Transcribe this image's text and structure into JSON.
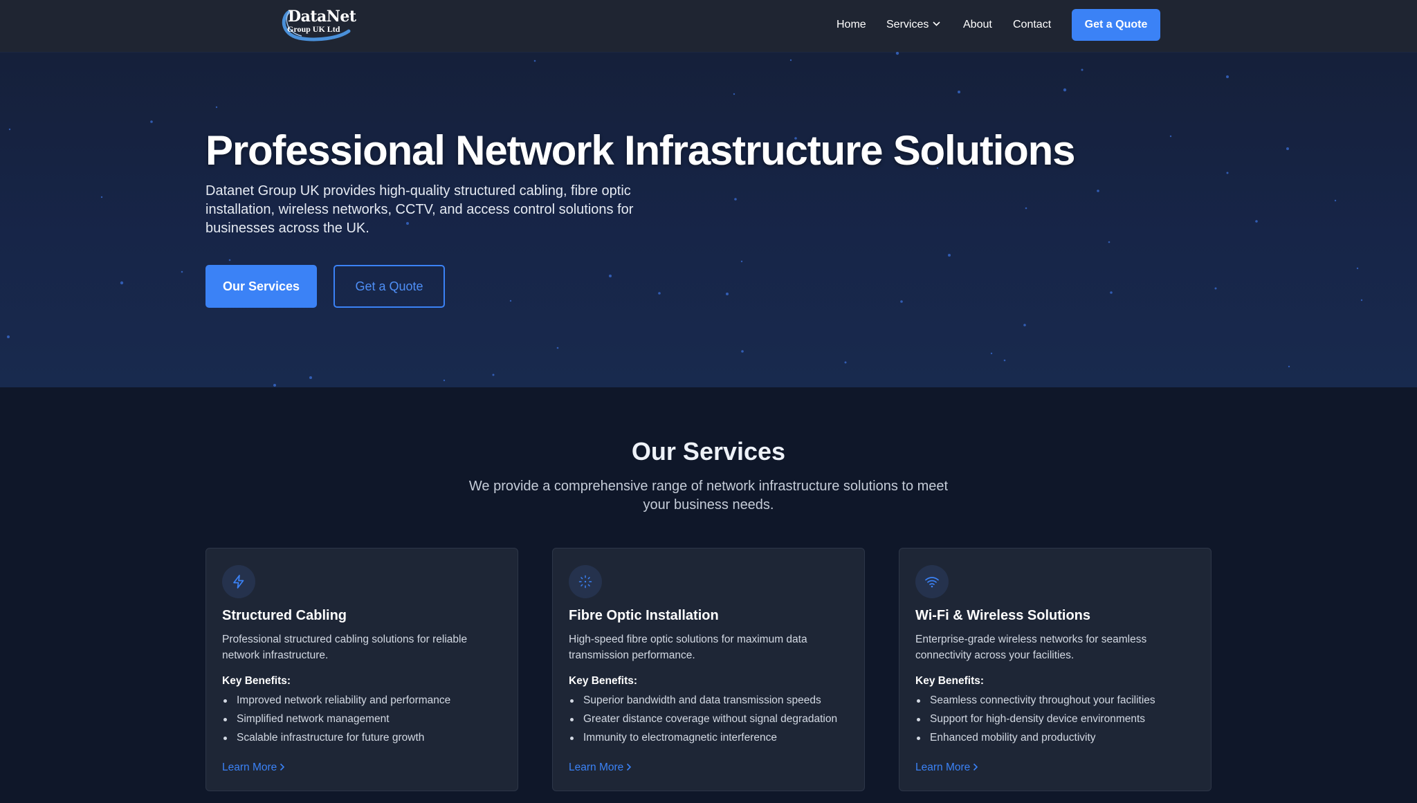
{
  "header": {
    "logo": {
      "name": "DataNet",
      "sub": "Group UK Ltd"
    },
    "nav": [
      {
        "label": "Home"
      },
      {
        "label": "Services"
      },
      {
        "label": "About"
      },
      {
        "label": "Contact"
      }
    ],
    "cta_label": "Get a Quote"
  },
  "hero": {
    "title": "Professional Network Infrastructure Solutions",
    "subtitle": "Datanet Group UK provides high-quality structured cabling, fibre optic installation, wireless networks, CCTV, and access control solutions for businesses across the UK.",
    "primary_label": "Our Services",
    "secondary_label": "Get a Quote"
  },
  "services": {
    "title": "Our Services",
    "subtitle": "We provide a comprehensive range of network infrastructure solutions to meet your business needs.",
    "cards": [
      {
        "icon": "lightning-icon",
        "title": "Structured Cabling",
        "description": "Professional structured cabling solutions for reliable network infrastructure.",
        "benefits_label": "Key Benefits:",
        "benefits": [
          "Improved network reliability and performance",
          "Simplified network management",
          "Scalable infrastructure for future growth"
        ],
        "link_label": "Learn More"
      },
      {
        "icon": "fibre-burst-icon",
        "title": "Fibre Optic Installation",
        "description": "High-speed fibre optic solutions for maximum data transmission performance.",
        "benefits_label": "Key Benefits:",
        "benefits": [
          "Superior bandwidth and data transmission speeds",
          "Greater distance coverage without signal degradation",
          "Immunity to electromagnetic interference"
        ],
        "link_label": "Learn More"
      },
      {
        "icon": "wifi-icon",
        "title": "Wi-Fi & Wireless Solutions",
        "description": "Enterprise-grade wireless networks for seamless connectivity across your facilities.",
        "benefits_label": "Key Benefits:",
        "benefits": [
          "Seamless connectivity throughout your facilities",
          "Support for high-density device environments",
          "Enhanced mobility and productivity"
        ],
        "link_label": "Learn More"
      }
    ]
  },
  "colors": {
    "accent": "#3b82f6",
    "header_bg": "#1f2532",
    "hero_bg": "#172548",
    "section_bg": "#0f1729",
    "card_bg": "#1e2636"
  }
}
